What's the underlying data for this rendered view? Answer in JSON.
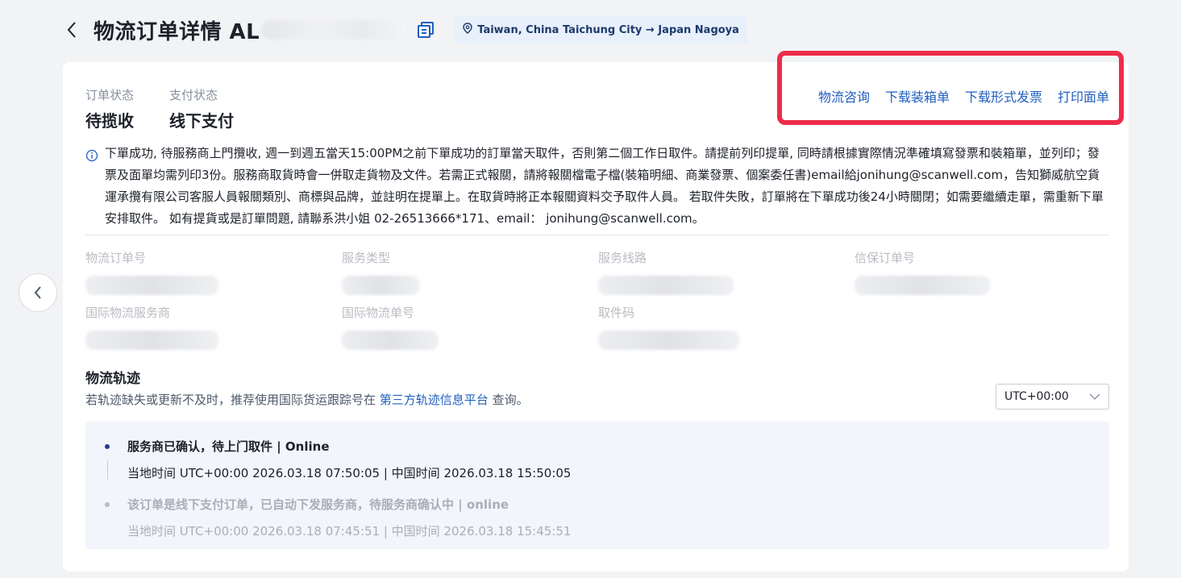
{
  "header": {
    "title": "物流订单详情 AL",
    "route": "Taiwan, China Taichung City → Japan Nagoya"
  },
  "status": {
    "order_status_label": "订单状态",
    "order_status_value": "待揽收",
    "payment_status_label": "支付状态",
    "payment_status_value": "线下支付"
  },
  "actions": {
    "consult": "物流咨询",
    "download_packing": "下载装箱单",
    "download_invoice": "下载形式发票",
    "print_label": "打印面单"
  },
  "notice": {
    "text": "下單成功, 待服務商上門攬收, 週一到週五當天15:00PM之前下單成功的訂單當天取件，否則第二個工作日取件。請提前列印提單, 同時請根據實際情況準確填寫發票和裝箱單，並列印；發票及面單均需列印3份。服務商取貨時會一併取走貨物及文件。若需正式報關，請將報關檔電子檔(裝箱明細、商業發票、個案委任書)email給jonihung@scanwell.com，告知獅威航空貨運承攬有限公司客服人員報關類別、商標與品牌，並註明在提單上。在取貨時將正本報關資料交予取件人員。 若取件失敗，訂單將在下單成功後24小時關閉；如需要繼續走單，需重新下單安排取件。 如有提貨或是訂單問題, 請聯系洪小姐 02-26513666*171、email： jonihung@scanwell.com。"
  },
  "fields": {
    "logistics_order_no": "物流订单号",
    "service_type": "服务类型",
    "service_route": "服务线路",
    "insurance_order_no": "信保订单号",
    "intl_provider": "国际物流服务商",
    "intl_tracking_no": "国际物流单号",
    "pickup_code": "取件码"
  },
  "tracking": {
    "title": "物流轨迹",
    "subtitle_prefix": "若轨迹缺失或更新不及时，推荐使用国际货运跟踪号在 ",
    "subtitle_link": "第三方轨迹信息平台",
    "subtitle_suffix": " 查询。",
    "timezone": "UTC+00:00",
    "events": [
      {
        "title": "服务商已确认，待上门取件 | Online",
        "time": "当地时间 UTC+00:00 2026.03.18 07:50:05 | 中国时间 2026.03.18 15:50:05"
      },
      {
        "title": "该订单是线下支付订单，已自动下发服务商，待服务商确认中 | online",
        "time": "当地时间 UTC+00:00 2026.03.18 07:45:51 | 中国时间 2026.03.18 15:45:51"
      }
    ]
  },
  "colors": {
    "accent": "#1f5fbf",
    "highlight": "#ee2c4a",
    "track_bg": "#f2f5fb"
  }
}
